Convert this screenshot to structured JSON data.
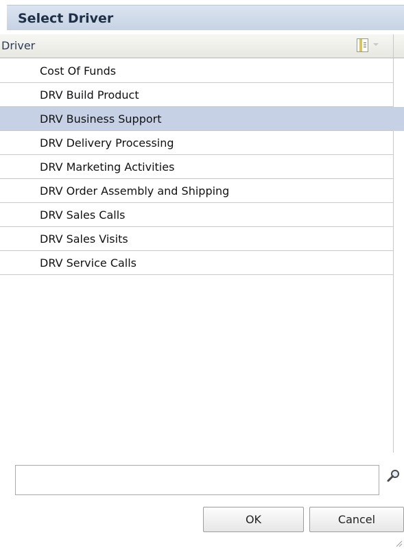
{
  "dialog": {
    "title": "Select Driver"
  },
  "table": {
    "column_header": "Driver",
    "column_menu_icon": "column-menu-icon",
    "rows": [
      {
        "label": "Cost Of Funds",
        "selected": false
      },
      {
        "label": "DRV Build Product",
        "selected": false
      },
      {
        "label": "DRV Business Support",
        "selected": true
      },
      {
        "label": "DRV Delivery Processing",
        "selected": false
      },
      {
        "label": "DRV Marketing Activities",
        "selected": false
      },
      {
        "label": "DRV Order Assembly and Shipping",
        "selected": false
      },
      {
        "label": "DRV Sales Calls",
        "selected": false
      },
      {
        "label": "DRV Sales Visits",
        "selected": false
      },
      {
        "label": "DRV Service Calls",
        "selected": false
      }
    ]
  },
  "search": {
    "value": "",
    "placeholder": "",
    "icon": "search-icon"
  },
  "buttons": {
    "ok_label": "OK",
    "cancel_label": "Cancel"
  },
  "colors": {
    "selected_row": "#c7d1e6",
    "title_text": "#1f2f46",
    "header_text": "#2d3b55"
  }
}
